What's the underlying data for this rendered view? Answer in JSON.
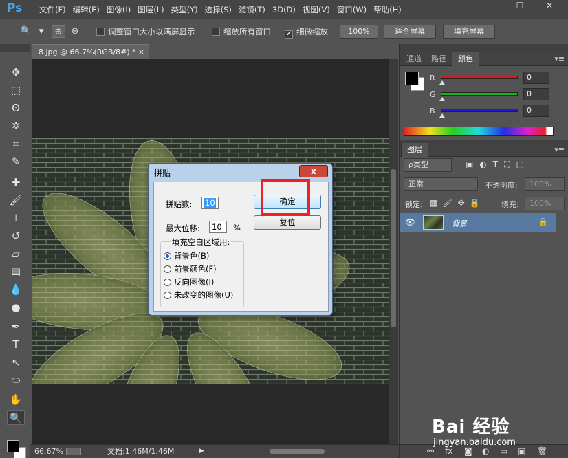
{
  "app": {
    "logo": "Ps"
  },
  "menu": [
    "文件(F)",
    "编辑(E)",
    "图像(I)",
    "图层(L)",
    "类型(Y)",
    "选择(S)",
    "滤镜(T)",
    "3D(D)",
    "视图(V)",
    "窗口(W)",
    "帮助(H)"
  ],
  "window_controls": {
    "minimize": "—",
    "maximize": "☐",
    "close": "✕"
  },
  "options": {
    "resize_windows": {
      "label": "调整窗口大小以满屏显示",
      "checked": false
    },
    "zoom_all": {
      "label": "缩放所有窗口",
      "checked": false
    },
    "scrubby_zoom": {
      "label": "细微缩放",
      "checked": true
    },
    "zoom_100": "100%",
    "fit_screen": "适合屏幕",
    "fill_screen": "填充屏幕"
  },
  "document": {
    "tab_title": "8.jpg @ 66.7%(RGB/8#) *",
    "tab_close": "×"
  },
  "status": {
    "zoom": "66.67%",
    "doc_size": "文档:1.46M/1.46M",
    "arrow": "▶"
  },
  "color_panel": {
    "tabs": [
      "通道",
      "路径",
      "颜色"
    ],
    "active_tab": "颜色",
    "channels": [
      {
        "name": "R",
        "value": "0",
        "color": "#d41a1a"
      },
      {
        "name": "G",
        "value": "0",
        "color": "#1ab41a"
      },
      {
        "name": "B",
        "value": "0",
        "color": "#1a1ad4"
      }
    ]
  },
  "layers_panel": {
    "tab": "图层",
    "filter": "ρ类型",
    "blend_mode": "正常",
    "opacity_label": "不透明度:",
    "opacity": "100%",
    "lock_label": "锁定:",
    "fill_label": "填充:",
    "fill": "100%",
    "layers": [
      {
        "name": "背景",
        "visible": true,
        "locked": true
      }
    ]
  },
  "dialog": {
    "title": "拼贴",
    "close": "x",
    "tiles_label": "拼贴数:",
    "tiles_value": "10",
    "offset_label": "最大位移:",
    "offset_value": "10",
    "offset_unit": "%",
    "ok": "确定",
    "reset": "复位",
    "fill_group": "填充空白区域用:",
    "options": [
      "背景色(B)",
      "前景颜色(F)",
      "反向图像(I)",
      "未改变的图像(U)"
    ],
    "selected_option": 0
  },
  "watermark": {
    "brand": "Bai 经验",
    "url": "jingyan.baidu.com"
  }
}
